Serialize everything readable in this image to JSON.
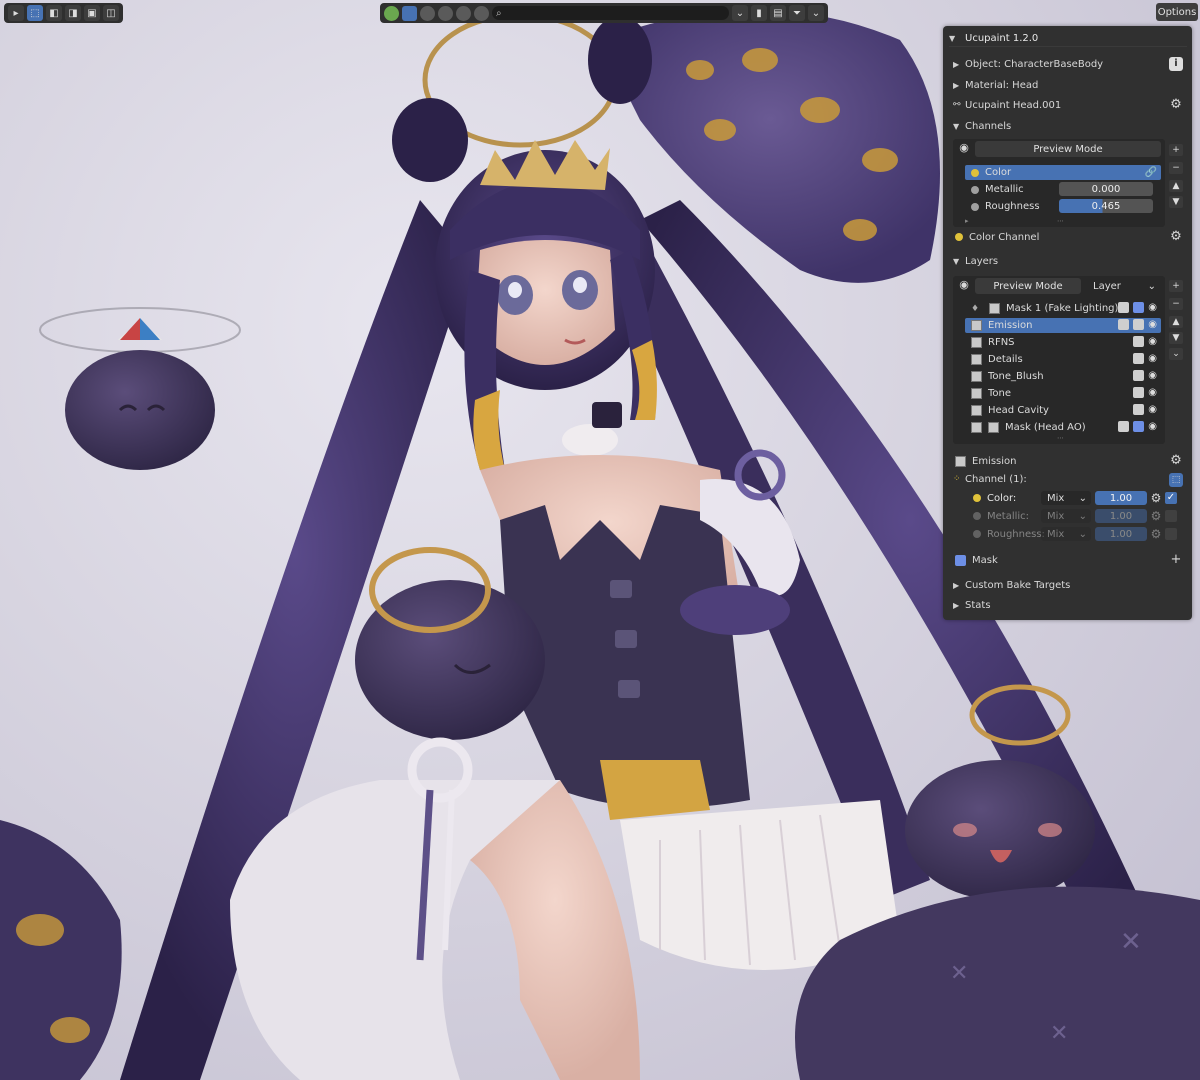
{
  "header": {
    "search_placeholder": "",
    "options_label": "Options"
  },
  "panel": {
    "title": "Ucupaint 1.2.0",
    "object_label": "Object: CharacterBaseBody",
    "material_label": "Material: Head",
    "tree_label": "Ucupaint Head.001",
    "channels_section": "Channels",
    "channels_preview_mode": "Preview Mode",
    "channels": [
      {
        "name": "Color",
        "color": "#e0c23a",
        "value": ""
      },
      {
        "name": "Metallic",
        "color": "#a0a0a0",
        "value": "0.000"
      },
      {
        "name": "Roughness",
        "color": "#a0a0a0",
        "value": "0.465",
        "fraction": 0.465
      }
    ],
    "color_channel_label": "Color Channel",
    "layers_section": "Layers",
    "layers_preview_mode": "Preview Mode",
    "layers_dropdown": "Layer",
    "layers": [
      {
        "name": "Mask 1 (Fake Lighting)",
        "indent": true
      },
      {
        "name": "Emission",
        "indent": false,
        "selected": true
      },
      {
        "name": "RFNS",
        "indent": false
      },
      {
        "name": "Details",
        "indent": false
      },
      {
        "name": "Tone_Blush",
        "indent": false
      },
      {
        "name": "Tone",
        "indent": false
      },
      {
        "name": "Head Cavity",
        "indent": false
      },
      {
        "name": "Mask (Head AO)",
        "indent": true
      }
    ],
    "active_layer_label": "Emission",
    "channel_count_label": "Channel (1):",
    "layer_channels": [
      {
        "name": "Color:",
        "blend": "Mix",
        "value": "1.00",
        "enabled": true
      },
      {
        "name": "Metallic:",
        "blend": "Mix",
        "value": "1.00",
        "enabled": false
      },
      {
        "name": "Roughness:",
        "blend": "Mix",
        "value": "1.00",
        "enabled": false
      }
    ],
    "mask_label": "Mask",
    "custom_bake_label": "Custom Bake Targets",
    "stats_label": "Stats"
  },
  "colors": {
    "accent": "#4772b3",
    "panel_bg": "#303030"
  }
}
